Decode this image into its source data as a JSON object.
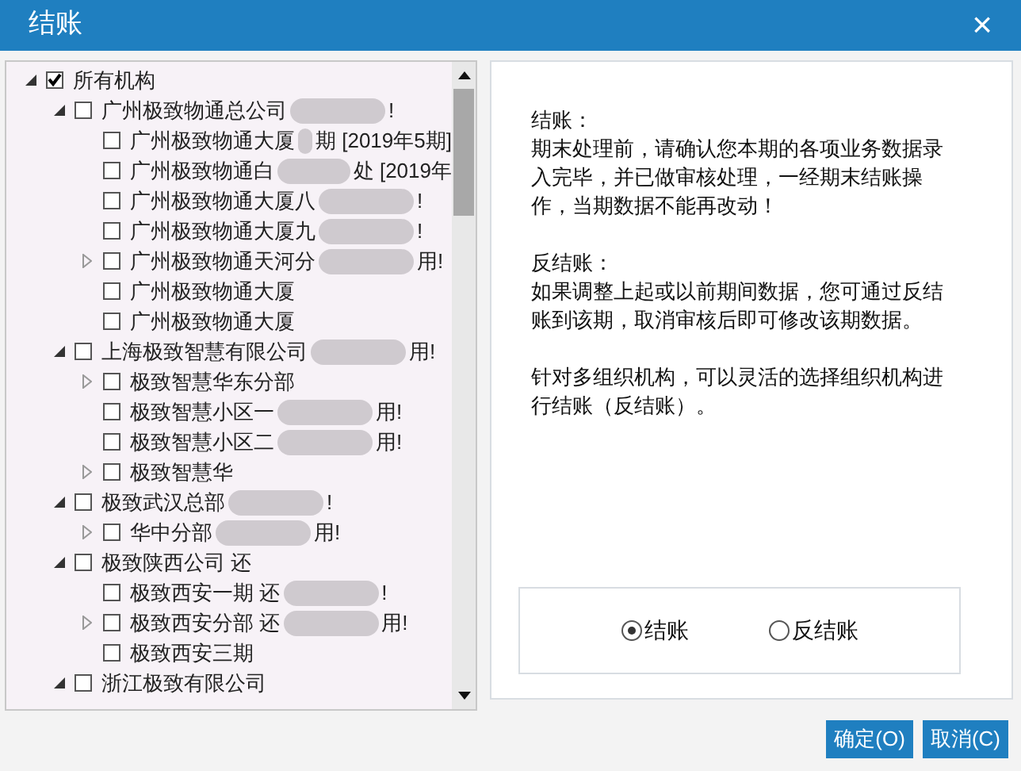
{
  "window": {
    "title": "结账",
    "close": "×"
  },
  "tree": [
    {
      "label": "所有机构",
      "checked": true,
      "expanded": true,
      "children": [
        {
          "label": "广州极致物通总公司",
          "tail": "!",
          "checked": false,
          "expanded": true,
          "children": [
            {
              "label": "广州极致物通大厦",
              "tail": "期 [2019年5期]",
              "checked": false
            },
            {
              "label": "广州极致物通白",
              "tail": "处 [2019年",
              "checked": false
            },
            {
              "label": "广州极致物通大厦八",
              "tail": "!",
              "checked": false
            },
            {
              "label": "广州极致物通大厦九",
              "tail": "!",
              "checked": false
            },
            {
              "label": "广州极致物通天河分",
              "tail": "用!",
              "checked": false,
              "expanded": false
            },
            {
              "label": "广州极致物通大厦",
              "checked": false
            },
            {
              "label": "广州极致物通大厦",
              "checked": false
            }
          ]
        },
        {
          "label": "上海极致智慧有限公司",
          "tail": "用!",
          "checked": false,
          "expanded": true,
          "children": [
            {
              "label": "极致智慧华东分部",
              "checked": false,
              "expanded": false
            },
            {
              "label": "极致智慧小区一",
              "tail": "用!",
              "checked": false
            },
            {
              "label": "极致智慧小区二",
              "tail": "用!",
              "checked": false
            },
            {
              "label": "极致智慧华",
              "checked": false,
              "expanded": false
            }
          ]
        },
        {
          "label": "极致武汉总部",
          "tail": "!",
          "checked": false,
          "expanded": true,
          "children": [
            {
              "label": "华中分部",
              "tail": "用!",
              "checked": false,
              "expanded": false
            }
          ]
        },
        {
          "label": "极致陕西公司 还",
          "checked": false,
          "expanded": true,
          "children": [
            {
              "label": "极致西安一期 还",
              "tail": "!",
              "checked": false
            },
            {
              "label": "极致西安分部 还",
              "tail": "用!",
              "checked": false,
              "expanded": false
            },
            {
              "label": "极致西安三期",
              "checked": false
            }
          ]
        },
        {
          "label": "浙江极致有限公司",
          "checked": false,
          "expanded": true
        }
      ]
    }
  ],
  "info": [
    {
      "heading": "结账：",
      "body": "期末处理前，请确认您本期的各项业务数据录入完毕，并已做审核处理，一经期末结账操作，当期数据不能再改动！"
    },
    {
      "heading": "反结账：",
      "body": "如果调整上起或以前期间数据，您可通过反结账到该期，取消审核后即可修改该期数据。"
    },
    {
      "body": "针对多组织机构，可以灵活的选择组织机构进行结账（反结账）。"
    }
  ],
  "options": [
    {
      "label": "结账",
      "selected": true
    },
    {
      "label": "反结账",
      "selected": false
    }
  ],
  "buttons": [
    "确定(O)",
    "取消(C)"
  ]
}
